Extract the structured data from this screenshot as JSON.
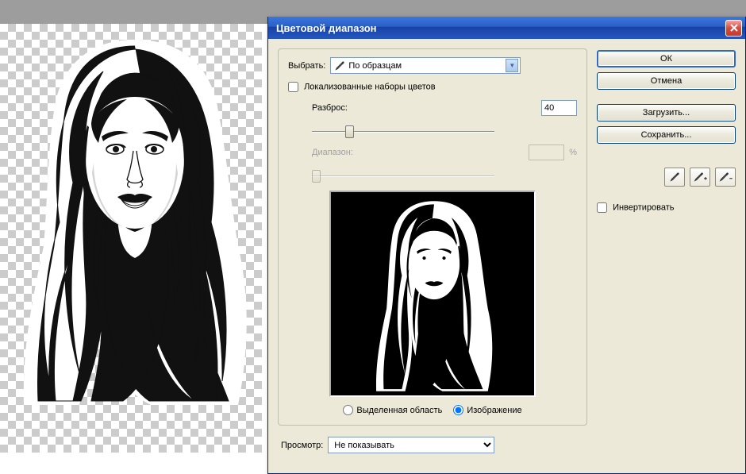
{
  "dialog": {
    "title": "Цветовой диапазон",
    "select_label": "Выбрать:",
    "select_value": "По образцам",
    "localized_checkbox": "Локализованные наборы цветов",
    "fuzziness_label": "Разброс:",
    "fuzziness_value": "40",
    "range_label": "Диапазон:",
    "range_value": "",
    "range_unit": "%",
    "radio_selection": "Выделенная область",
    "radio_image": "Изображение",
    "preview_label": "Просмотр:",
    "preview_value": "Не показывать"
  },
  "buttons": {
    "ok": "ОК",
    "cancel": "Отмена",
    "load": "Загрузить...",
    "save": "Сохранить..."
  },
  "options": {
    "invert": "Инвертировать"
  },
  "icons": {
    "eyedropper": "eyedropper-icon",
    "eyedropper_plus": "eyedropper-plus-icon",
    "eyedropper_minus": "eyedropper-minus-icon"
  }
}
